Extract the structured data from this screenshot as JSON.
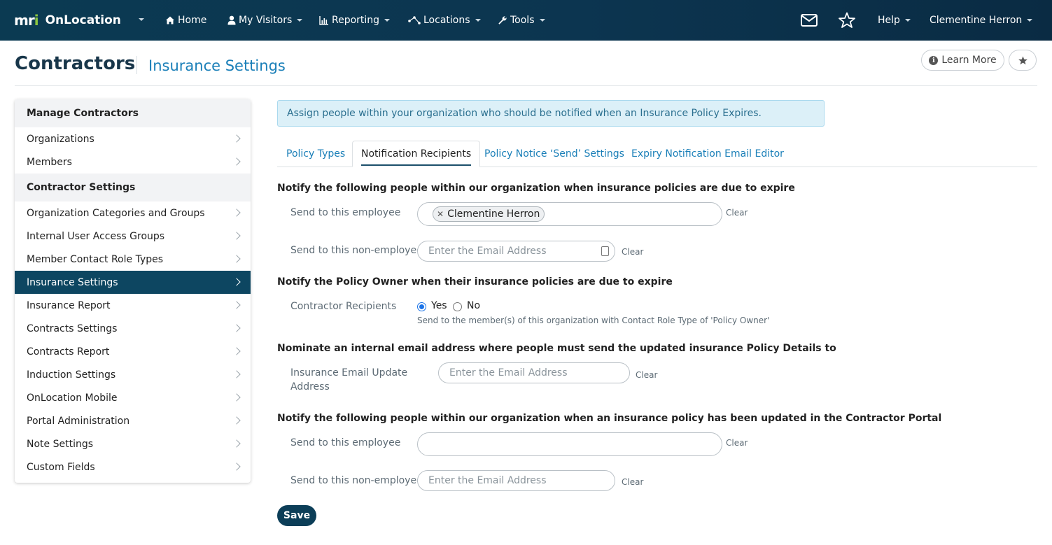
{
  "navbar": {
    "brand_mri": "mri",
    "brand_name": "OnLocation",
    "home": "Home",
    "my_visitors": "My Visitors",
    "reporting": "Reporting",
    "locations": "Locations",
    "tools": "Tools",
    "help": "Help",
    "user_name": "Clementine Herron",
    "icons": {
      "messages": "envelope-icon",
      "favorites": "star-icon"
    }
  },
  "header": {
    "title": "Contractors",
    "subtitle": "Insurance Settings",
    "learn_more": "Learn More"
  },
  "sidebar": {
    "sections": [
      {
        "title": "Manage Contractors",
        "items": [
          "Organizations",
          "Members"
        ]
      },
      {
        "title": "Contractor Settings",
        "items": [
          "Organization Categories and Groups",
          "Internal User Access Groups",
          "Member Contact Role Types",
          "Insurance Settings",
          "Insurance Report",
          "Contracts Settings",
          "Contracts Report",
          "Induction Settings",
          "OnLocation Mobile",
          "Portal Administration",
          "Note Settings",
          "Custom Fields"
        ]
      }
    ],
    "active_item": "Insurance Settings"
  },
  "main": {
    "alert": "Assign people within your organization who should be notified when an Insurance Policy Expires.",
    "tabs": [
      {
        "label": "Policy Types"
      },
      {
        "label": "Notification Recipients",
        "active": true
      },
      {
        "label": "Policy Notice ‘Send’ Settings"
      },
      {
        "label": "Expiry Notification Email Editor"
      }
    ],
    "section1": {
      "heading": "Notify the following people within our organization when insurance policies are due to expire",
      "employee_label": "Send to this employee",
      "employee_chip": "Clementine Herron",
      "non_employee_label": "Send to this non-employee",
      "non_employee_placeholder": "Enter the Email Address",
      "clear": "Clear"
    },
    "section2": {
      "heading": "Notify the Policy Owner when their insurance policies are due to expire",
      "label": "Contractor Recipients",
      "yes": "Yes",
      "no": "No",
      "selected": "Yes",
      "hint": "Send to the member(s) of this organization with Contact Role Type of 'Policy Owner'"
    },
    "section3": {
      "heading": "Nominate an internal email address where people must send the updated insurance Policy Details to",
      "label": "Insurance Email Update Address",
      "placeholder": "Enter the Email Address",
      "clear": "Clear"
    },
    "section4": {
      "heading": "Notify the following people within our organization when an insurance policy has been updated in the Contractor Portal",
      "employee_label": "Send to this employee",
      "non_employee_label": "Send to this non-employee",
      "non_employee_placeholder": "Enter the Email Address",
      "clear": "Clear"
    },
    "save": "Save"
  },
  "colors": {
    "navbar": "#0b3a52",
    "accent_link": "#1a7fb8",
    "active_sidebar": "#0d4661",
    "alert_bg": "#dcf0f8",
    "save_button": "#0c3e58",
    "brand_dot": "#8cc63f"
  }
}
